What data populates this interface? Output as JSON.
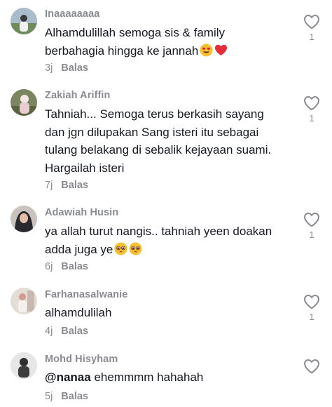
{
  "comments": [
    {
      "author": "Inaaaaaaaa",
      "text": "Alhamdulillah semoga sis & family berbahagia hingga ke jannah",
      "emojis": [
        "heart-eyes-emoji",
        "red-heart-emoji"
      ],
      "time": "3j",
      "reply": "Balas",
      "likes": "1",
      "avatar_bg": "#9fb3c2"
    },
    {
      "author": "Zakiah Ariffin",
      "text": "Tahniah... Semoga terus berkasih sayang dan jgn dilupakan Sang isteri itu sebagai tulang belakang di sebalik kejayaan suami. Hargailah isteri",
      "time": "7j",
      "reply": "Balas",
      "likes": "1",
      "avatar_bg": "#6f7a55"
    },
    {
      "author": "Adawiah Husin",
      "text": "ya allah turut nangis.. tahniah yeen doakan adda juga ye",
      "emojis": [
        "pleading-face-emoji",
        "pleading-face-emoji"
      ],
      "time": "6j",
      "reply": "Balas",
      "likes": "1",
      "avatar_bg": "#3a3f44"
    },
    {
      "author": "Farhanasalwanie",
      "text": "alhamdulilah",
      "time": "4j",
      "reply": "Balas",
      "likes": "1",
      "avatar_bg": "#d9cfc6"
    },
    {
      "author": "Mohd Hisyham",
      "mention": "@nanaa",
      "text": " ehemmmm hahahah",
      "time": "5j",
      "reply": "Balas",
      "likes": "",
      "avatar_bg": "#4b4b4b"
    }
  ],
  "colors": {
    "text": "#161823",
    "muted": "#8a8b91"
  },
  "icons": {
    "like": "heart-outline-icon"
  }
}
